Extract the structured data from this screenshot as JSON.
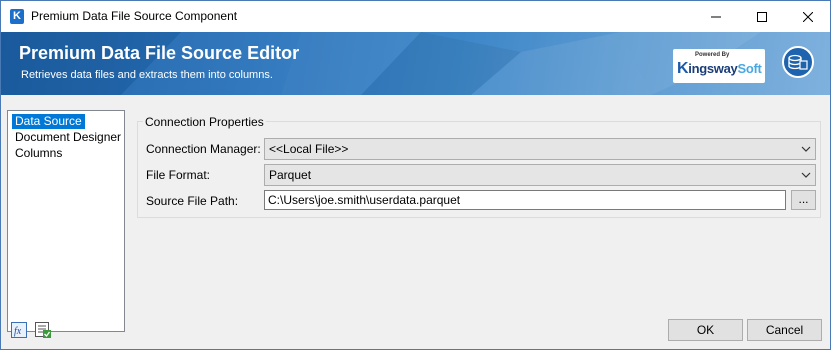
{
  "window": {
    "title": "Premium Data File Source Component",
    "app_icon_letter": "K"
  },
  "banner": {
    "title": "Premium Data File Source Editor",
    "subtitle": "Retrieves data files and extracts them into columns.",
    "brand_powered": "Powered By",
    "brand_k": "K",
    "brand_ingsway": "ingsway",
    "brand_soft": "Soft"
  },
  "nav": {
    "items": [
      {
        "label": "Data Source",
        "selected": true
      },
      {
        "label": "Document Designer",
        "selected": false
      },
      {
        "label": "Columns",
        "selected": false
      }
    ]
  },
  "connection": {
    "group_title": "Connection Properties",
    "manager_label": "Connection Manager:",
    "manager_value": "<<Local File>>",
    "format_label": "File Format:",
    "format_value": "Parquet",
    "path_label": "Source File Path:",
    "path_value": "C:\\Users\\joe.smith\\userdata.parquet",
    "browse_label": "..."
  },
  "footer": {
    "ok_label": "OK",
    "cancel_label": "Cancel",
    "icons": [
      "expression-icon",
      "variables-icon"
    ]
  },
  "colors": {
    "banner_start": "#1b5fa6",
    "banner_end": "#7fb1dd",
    "selection": "#0078d7"
  }
}
